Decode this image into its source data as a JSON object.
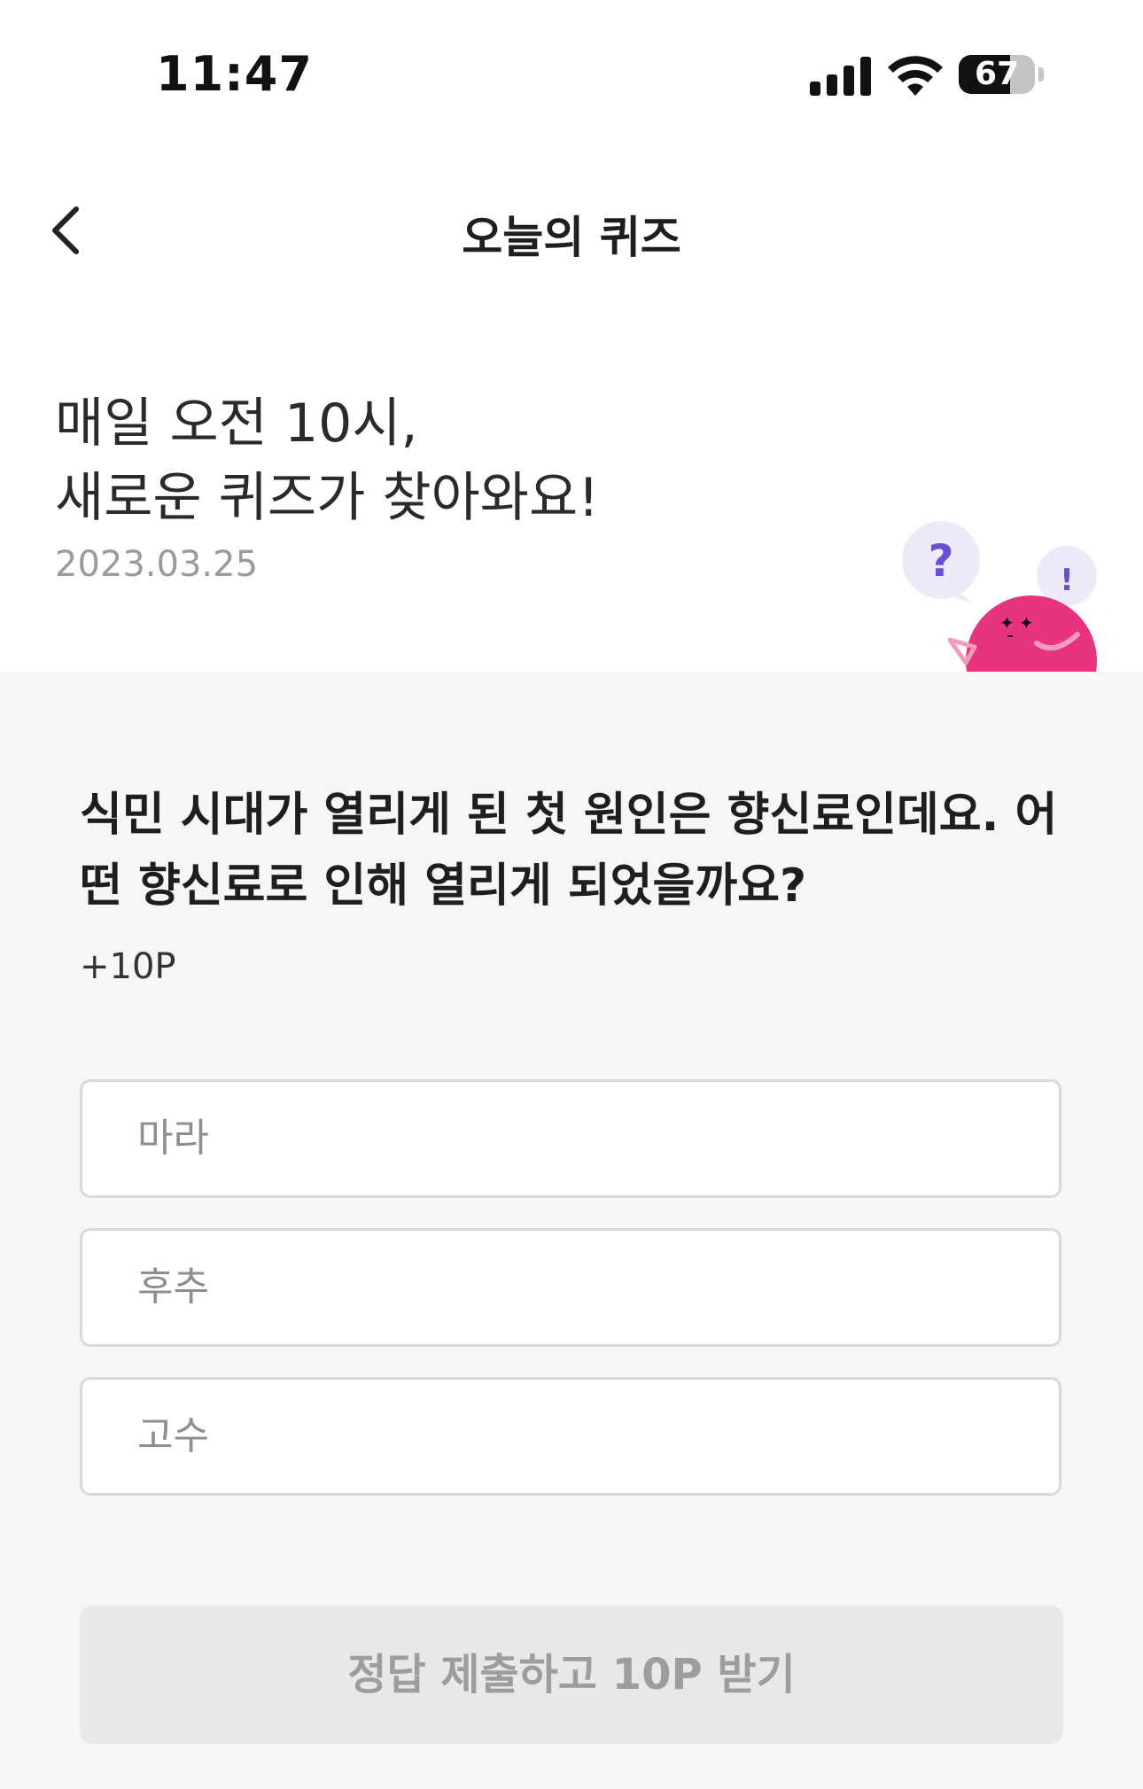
{
  "status_bar": {
    "time": "11:47",
    "battery_level": "67",
    "battery_fraction": 0.67,
    "icons": [
      "signal-icon",
      "wifi-icon",
      "battery-icon"
    ]
  },
  "nav": {
    "back_icon": "chevron-left-icon",
    "title": "오늘의 퀴즈"
  },
  "intro": {
    "line1": "매일 오전 10시,",
    "line2": "새로운 퀴즈가 찾아와요!",
    "date": "2023.03.25"
  },
  "mascot": {
    "bubble_question": "?",
    "bubble_exclaim": "!"
  },
  "quiz": {
    "question": "식민 시대가 열리게 된 첫 원인은 향신료인데요. 어떤 향신료로 인해 열리게 되었을까요?",
    "points": "+10P",
    "options": [
      {
        "label": "마라"
      },
      {
        "label": "후추"
      },
      {
        "label": "고수"
      }
    ],
    "submit_label": "정답 제출하고 10P 받기"
  },
  "colors": {
    "accent_pink": "#e8337e",
    "bubble_purple": "#6a4fd6",
    "section_bg": "#f6f6f6",
    "button_disabled_bg": "#e8e8e8"
  }
}
